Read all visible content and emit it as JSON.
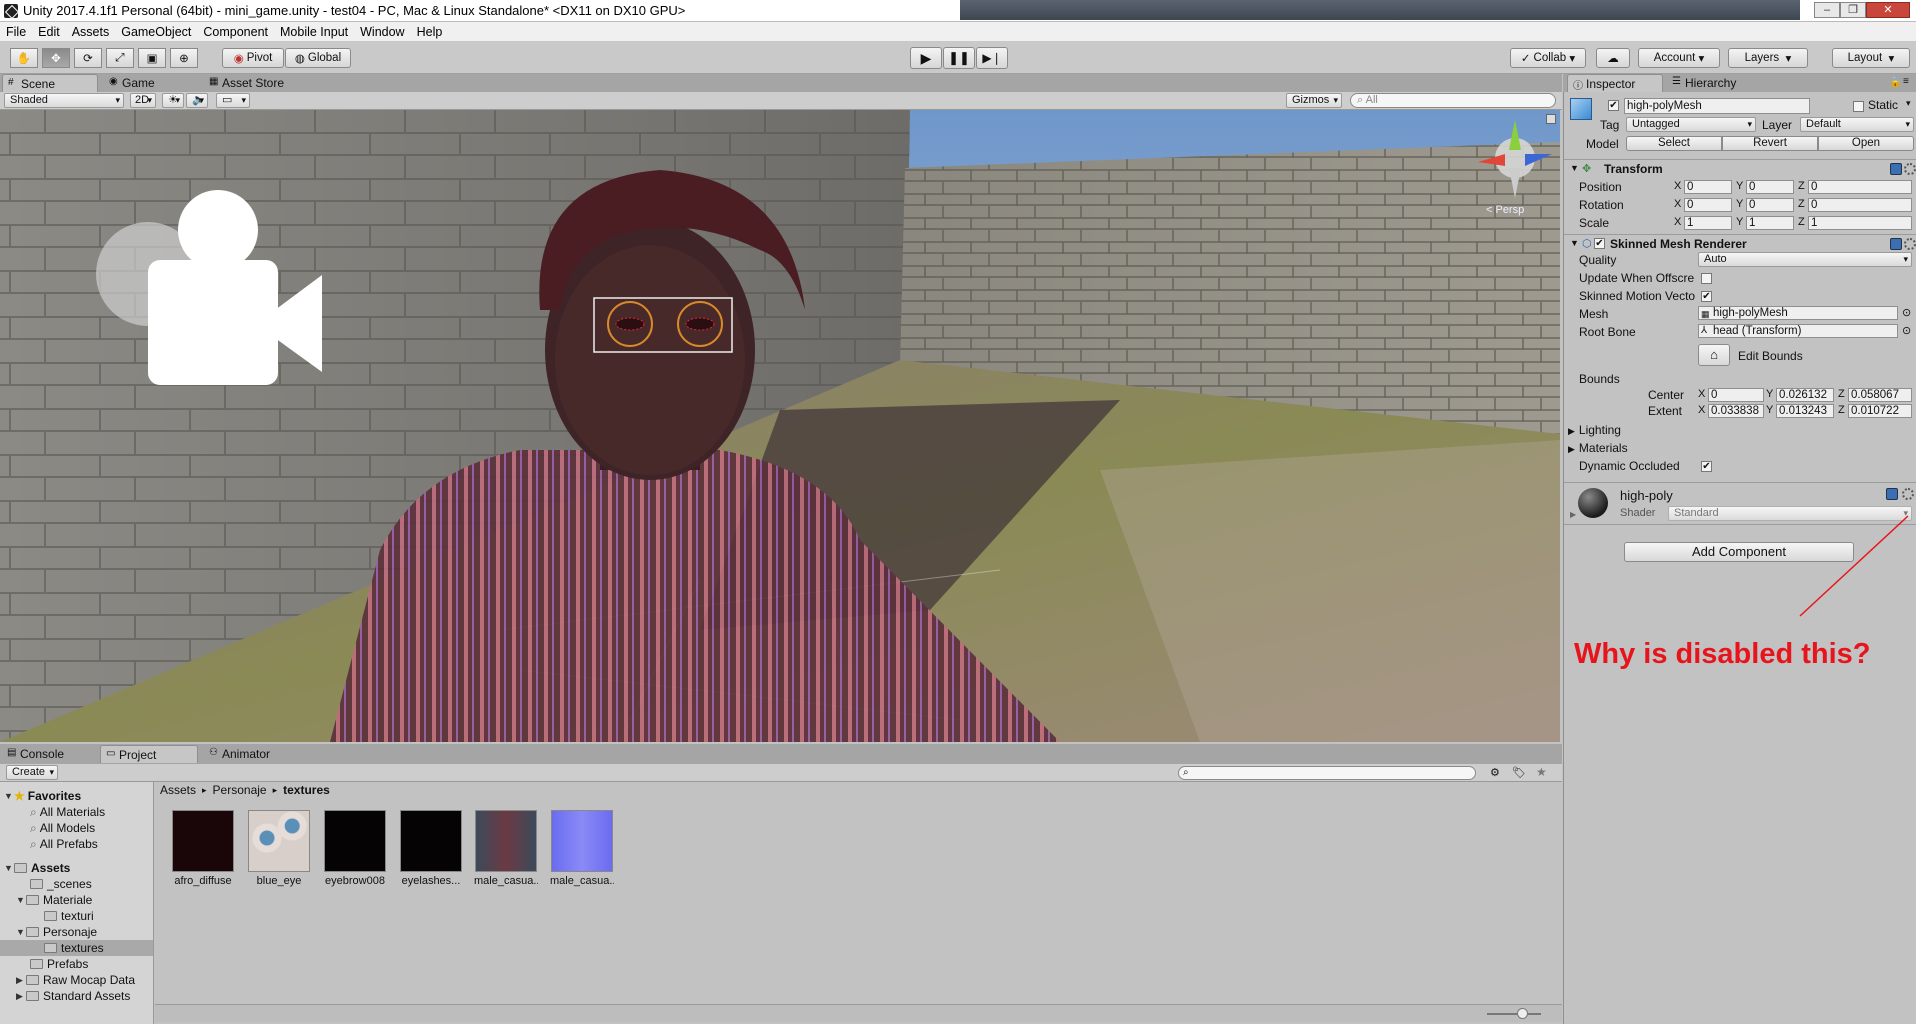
{
  "window": {
    "title": "Unity 2017.4.1f1 Personal (64bit) - mini_game.unity - test04 - PC, Mac & Linux Standalone* <DX11 on DX10 GPU>"
  },
  "menu": [
    "File",
    "Edit",
    "Assets",
    "GameObject",
    "Component",
    "Mobile Input",
    "Window",
    "Help"
  ],
  "toolbar": {
    "pivot": "Pivot",
    "global": "Global",
    "collab": "Collab",
    "account": "Account",
    "layers": "Layers",
    "layout": "Layout"
  },
  "scene_tabs": [
    "Scene",
    "Game",
    "Asset Store"
  ],
  "scene_bar": {
    "shading": "Shaded",
    "mode2d": "2D",
    "gizmos": "Gizmos",
    "search_placeholder": "All"
  },
  "scene_view": {
    "persp": "< Persp",
    "annotation": "Why is disabled this?",
    "annotation_color": "#e8141b"
  },
  "bottom_tabs": [
    "Console",
    "Project",
    "Animator"
  ],
  "project": {
    "create": "Create",
    "favorites_label": "Favorites",
    "favorites": [
      "All Materials",
      "All Models",
      "All Prefabs"
    ],
    "assets_label": "Assets",
    "folders": [
      "_scenes",
      "Materiale",
      "texturi",
      "Personaje",
      "textures",
      "Prefabs",
      "Raw Mocap Data",
      "Standard Assets"
    ],
    "breadcrumb": [
      "Assets",
      "Personaje",
      "textures"
    ],
    "items": [
      {
        "name": "afro_diffuse"
      },
      {
        "name": "blue_eye"
      },
      {
        "name": "eyebrow008"
      },
      {
        "name": "eyelashes..."
      },
      {
        "name": "male_casua..."
      },
      {
        "name": "male_casua..."
      }
    ]
  },
  "inspector_tabs": [
    "Inspector",
    "Hierarchy"
  ],
  "inspector": {
    "object_name": "high-polyMesh",
    "static_label": "Static",
    "tag_label": "Tag",
    "tag_value": "Untagged",
    "layer_label": "Layer",
    "layer_value": "Default",
    "model_label": "Model",
    "model_buttons": [
      "Select",
      "Revert",
      "Open"
    ],
    "transform": {
      "title": "Transform",
      "rows": [
        {
          "label": "Position",
          "x": "0",
          "y": "0",
          "z": "0"
        },
        {
          "label": "Rotation",
          "x": "0",
          "y": "0",
          "z": "0"
        },
        {
          "label": "Scale",
          "x": "1",
          "y": "1",
          "z": "1"
        }
      ]
    },
    "smr": {
      "title": "Skinned Mesh Renderer",
      "quality_label": "Quality",
      "quality_value": "Auto",
      "update_offscreen": "Update When Offscre",
      "skinned_motion": "Skinned Motion Vecto",
      "mesh_label": "Mesh",
      "mesh_value": "high-polyMesh",
      "root_bone_label": "Root Bone",
      "root_bone_value": "head (Transform)",
      "edit_bounds": "Edit Bounds",
      "bounds_label": "Bounds",
      "center_label": "Center",
      "center": {
        "x": "0",
        "y": "0.026132",
        "z": "0.058067"
      },
      "extent_label": "Extent",
      "extent": {
        "x": "0.033838",
        "y": "0.013243",
        "z": "0.010722"
      },
      "lighting": "Lighting",
      "materials": "Materials",
      "dynamic_occluded": "Dynamic Occluded"
    },
    "material": {
      "name": "high-poly",
      "shader_label": "Shader",
      "shader_value": "Standard"
    },
    "add_component": "Add Component"
  }
}
